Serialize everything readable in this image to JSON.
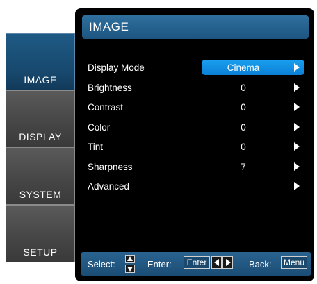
{
  "sidebar": {
    "tabs": [
      {
        "label": "IMAGE",
        "active": true
      },
      {
        "label": "DISPLAY",
        "active": false
      },
      {
        "label": "SYSTEM",
        "active": false
      },
      {
        "label": "SETUP",
        "active": false
      }
    ]
  },
  "panel": {
    "title": "IMAGE",
    "items": [
      {
        "label": "Display Mode",
        "value": "Cinema",
        "selected": true
      },
      {
        "label": "Brightness",
        "value": "0"
      },
      {
        "label": "Contrast",
        "value": "0"
      },
      {
        "label": "Color",
        "value": "0"
      },
      {
        "label": "Tint",
        "value": "0"
      },
      {
        "label": "Sharpness",
        "value": "7"
      },
      {
        "label": "Advanced",
        "value": ""
      }
    ]
  },
  "footer": {
    "select_label": "Select:",
    "enter_label": "Enter:",
    "enter_key": "Enter",
    "back_label": "Back:",
    "back_key": "Menu"
  },
  "colors": {
    "accent": "#0a8fe6",
    "header": "#25628f",
    "active_tab": "#17486d",
    "inactive_tab": "#4a4a4a",
    "panel_bg": "#000000"
  },
  "icons": {
    "item_arrow": "triangle-right-icon",
    "select_keys": "up-down-arrows-icon",
    "enter_keys": "left-right-arrows-icon"
  }
}
